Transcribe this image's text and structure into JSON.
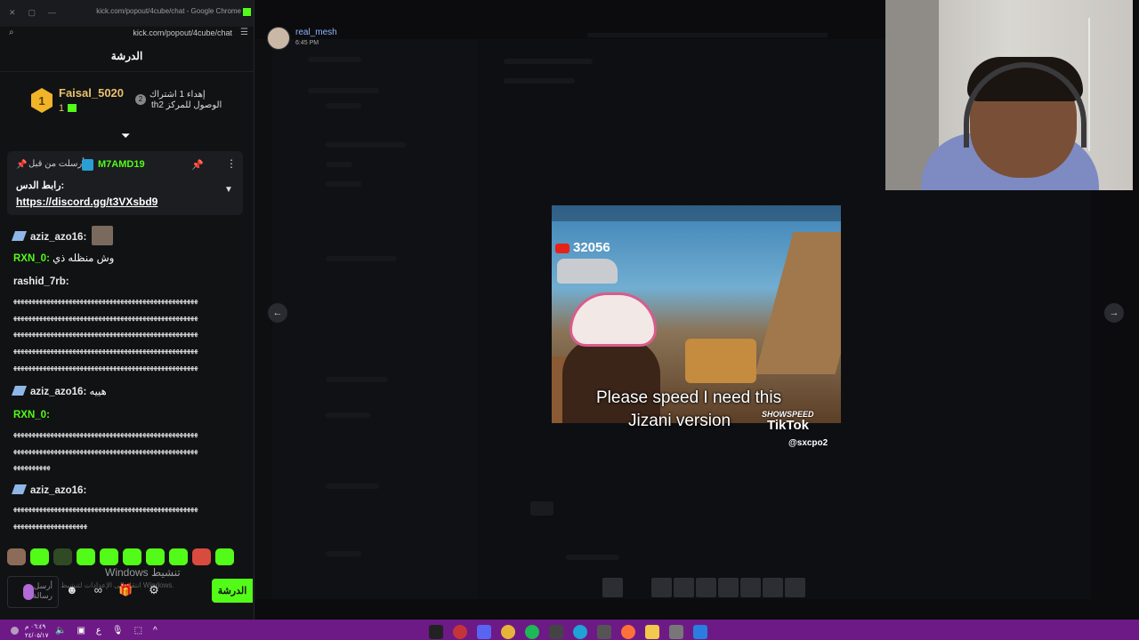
{
  "chat_window": {
    "title": "kick.com/popout/4cube/chat - Google Chrome",
    "url": "kick.com/popout/4cube/chat",
    "header": "الدرشة",
    "leaderboard": {
      "rank": "1",
      "name": "Faisal_5020",
      "count": "1",
      "gift_badge": "2",
      "gift_text_line1": "إهداء 1 اشتراك",
      "gift_text_line2": "thالوصول للمركز 2"
    },
    "pinned": {
      "sent_by": "أرسلت من قبل",
      "sender": "M7AMD19",
      "label": "رابط الدس:",
      "link": "https://discord.gg/t3VXsbd9"
    },
    "messages": [
      {
        "user": "aziz_azo16:",
        "text": ""
      },
      {
        "user": "RXN_0:",
        "text": "وش منظله ذي"
      },
      {
        "user": "rashid_7rb:",
        "text": ""
      },
      {
        "user": "aziz_azo16:",
        "text": "هييه"
      },
      {
        "user": "RXN_0:",
        "text": ""
      },
      {
        "user": "aziz_azo16:",
        "text": ""
      }
    ],
    "spam_line": "ﻬﻬﻬﻬﻬﻬﻬﻬﻬﻬﻬﻬﻬﻬﻬﻬﻬﻬﻬﻬﻬﻬﻬﻬﻬﻬﻬﻬﻬﻬﻬﻬﻬﻬﻬﻬﻬﻬﻬﻬﻬﻬﻬﻬﻬﻬﻬﻬﻬﻬ",
    "spam_short1": "ﻬﻬﻬﻬﻬﻬﻬﻬﻬﻬ",
    "spam_short2": "ﻬﻬﻬﻬﻬﻬﻬﻬﻬﻬﻬﻬﻬﻬﻬﻬﻬﻬﻬﻬ",
    "input_placeholder": "أرسل رسالة",
    "send_label": "الدرشة",
    "watermark1": "Windows تنشيط",
    "watermark2": "انتقل إلى الإعدادات لتنشيط Windows."
  },
  "viewer": {
    "author": "real_mesh",
    "time": "6:45 PM",
    "prev_arrow": "←",
    "next_arrow": "→"
  },
  "video": {
    "counter": "32056",
    "caption_line1": "Please speed I need this",
    "caption_line2": "Jizani version",
    "watermark": "SHOWSPEED",
    "tiktok": "TikTok",
    "handle": "@sxcpo2"
  },
  "taskbar": {
    "clock_time": "٠٦:٤٩ م",
    "clock_date": "٢٤/٠٥/١٧",
    "lang": "ع"
  },
  "colors": {
    "kick_green": "#53fc18",
    "taskbar": "#6d1a86",
    "link_blue": "#8ab4ff"
  }
}
